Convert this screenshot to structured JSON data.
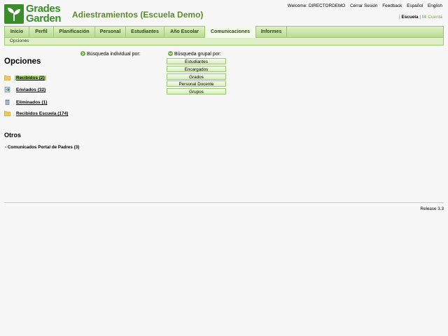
{
  "logo": {
    "line1": "Grades",
    "line2": "Garden"
  },
  "app_title": "Adiestramientos (Escuela Demo)",
  "top_links": {
    "welcome": "Welcome: DIRECTORDEMO",
    "items": [
      "Cerrar Sesión",
      "Feedback",
      "Español",
      "English"
    ]
  },
  "account_links": {
    "escuela": "Escuela",
    "mi_cuenta": "Mi Cuenta"
  },
  "nav": {
    "tabs": [
      "Inicio",
      "Perfil",
      "Planificación",
      "Personal",
      "Estudiantes",
      "Año Escolar",
      "Comunicaciones",
      "Informes"
    ],
    "active": "Comunicaciones"
  },
  "subnav": {
    "label": "Opciones"
  },
  "sidebar": {
    "title": "Opciones",
    "folders": [
      {
        "label": "Recibidos (2)",
        "icon": "folder-icon",
        "selected": true
      },
      {
        "label": "Enviados (32)",
        "icon": "sent-icon",
        "selected": false
      },
      {
        "label": "Eliminados (1)",
        "icon": "trash-icon",
        "selected": false
      },
      {
        "label": "Recibidos Escuela (174)",
        "icon": "folder-icon",
        "selected": false
      }
    ],
    "otros_title": "Otros",
    "otros_item": "Comunicados Portal de Padres (3)"
  },
  "search": {
    "individual_label": "Búsqueda individual por:",
    "group_label": "Búsqueda grupal por:",
    "group_options": [
      "Estudiantes",
      "Encargados",
      "Grados",
      "Personal Docente",
      "Grupos"
    ]
  },
  "footer": {
    "release": "Release 3.3"
  },
  "colors": {
    "brand": "#3a8d2a",
    "nav_bg": "#b8dc90",
    "selected": "#a6d66b"
  }
}
